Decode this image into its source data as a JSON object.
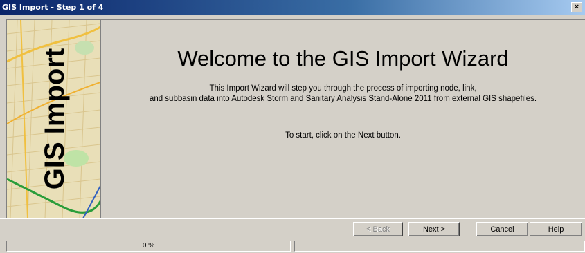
{
  "window": {
    "title": "GIS Import - Step 1 of 4",
    "close_glyph": "✕"
  },
  "sidebar": {
    "banner_text": "GIS Import"
  },
  "main": {
    "heading": "Welcome to the GIS Import Wizard",
    "description_line1": "This Import Wizard will step you through the process of importing node, link,",
    "description_line2": "and subbasin data into Autodesk Storm and Sanitary Analysis Stand-Alone 2011 from external GIS shapefiles.",
    "hint": "To start, click on the Next button."
  },
  "buttons": {
    "back": "< Back",
    "next": "Next >",
    "cancel": "Cancel",
    "help": "Help"
  },
  "status": {
    "progress_text": "0 %",
    "progress_value": 0
  }
}
